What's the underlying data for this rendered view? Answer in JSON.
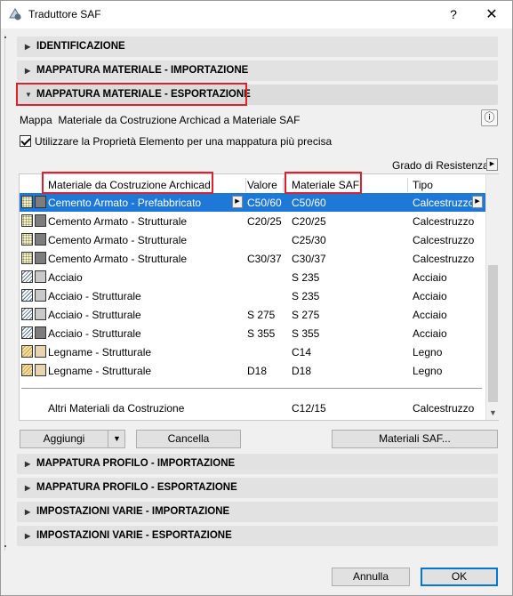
{
  "window": {
    "title": "Traduttore SAF",
    "help_glyph": "?",
    "close_glyph": "✕"
  },
  "sections_top": [
    {
      "label": "IDENTIFICAZIONE",
      "expanded": false
    },
    {
      "label": "MAPPATURA MATERIALE - IMPORTAZIONE",
      "expanded": false
    },
    {
      "label": "MAPPATURA MATERIALE - ESPORTAZIONE",
      "expanded": true
    }
  ],
  "mapping": {
    "label": "Mappa",
    "description": "Materiale da Costruzione Archicad a Materiale SAF",
    "info_glyph": "ⓘ",
    "checkbox_label": "Utilizzare la Proprietà Elemento per una mappatura più precisa",
    "checkbox_checked": true,
    "grade_label": "Grado di Resistenza"
  },
  "table": {
    "headers": {
      "material": "Materiale da Costruzione Archicad",
      "value": "Valore",
      "saf": "Materiale SAF",
      "type": "Tipo"
    },
    "rows": [
      {
        "material": "Cemento Armato - Prefabbricato",
        "value": "C50/60",
        "saf": "C50/60",
        "type": "Calcestruzzo"
      },
      {
        "material": "Cemento Armato - Strutturale",
        "value": "C20/25",
        "saf": "C20/25",
        "type": "Calcestruzzo"
      },
      {
        "material": "Cemento Armato - Strutturale",
        "value": "",
        "saf": "C25/30",
        "type": "Calcestruzzo"
      },
      {
        "material": "Cemento Armato - Strutturale",
        "value": "C30/37",
        "saf": "C30/37",
        "type": "Calcestruzzo"
      },
      {
        "material": "Acciaio",
        "value": "",
        "saf": "S 235",
        "type": "Acciaio"
      },
      {
        "material": "Acciaio - Strutturale",
        "value": "",
        "saf": "S 235",
        "type": "Acciaio"
      },
      {
        "material": "Acciaio - Strutturale",
        "value": "S 275",
        "saf": "S 275",
        "type": "Acciaio"
      },
      {
        "material": "Acciaio - Strutturale",
        "value": "S 355",
        "saf": "S 355",
        "type": "Acciaio"
      },
      {
        "material": "Legname - Strutturale",
        "value": "",
        "saf": "C14",
        "type": "Legno"
      },
      {
        "material": "Legname - Strutturale",
        "value": "D18",
        "saf": "D18",
        "type": "Legno"
      }
    ],
    "other": {
      "material": "Altri Materiali da Costruzione",
      "value": "",
      "saf": "C12/15",
      "type": "Calcestruzzo"
    }
  },
  "buttons": {
    "add": "Aggiungi",
    "delete": "Cancella",
    "saf_materials": "Materiali SAF...",
    "cancel": "Annulla",
    "ok": "OK"
  },
  "sections_bottom": [
    {
      "label": "MAPPATURA PROFILO - IMPORTAZIONE"
    },
    {
      "label": "MAPPATURA PROFILO - ESPORTAZIONE"
    },
    {
      "label": "IMPOSTAZIONI VARIE - IMPORTAZIONE"
    },
    {
      "label": "IMPOSTAZIONI VARIE - ESPORTAZIONE"
    }
  ],
  "colors": {
    "selection": "#1e78d7",
    "highlight_box": "#e0202a"
  }
}
